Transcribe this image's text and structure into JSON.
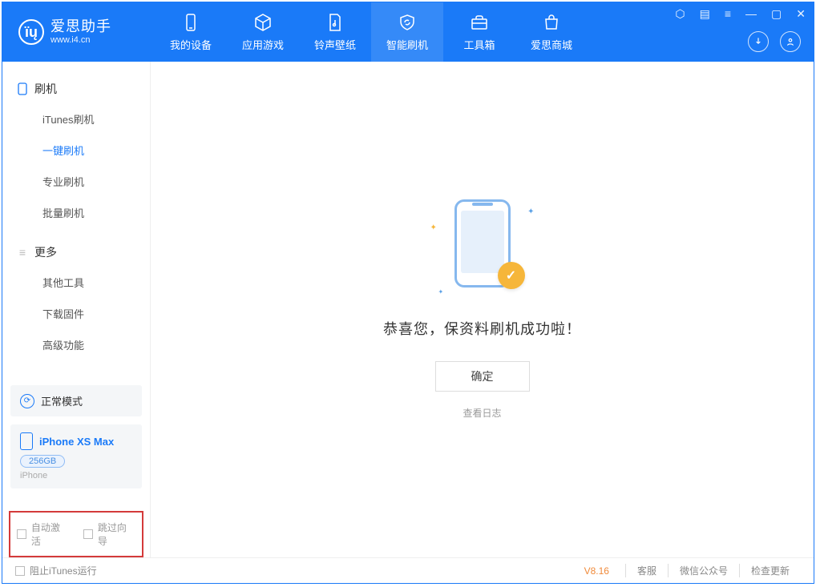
{
  "app": {
    "title": "爱思助手",
    "subtitle": "www.i4.cn"
  },
  "nav": {
    "items": [
      {
        "label": "我的设备"
      },
      {
        "label": "应用游戏"
      },
      {
        "label": "铃声壁纸"
      },
      {
        "label": "智能刷机"
      },
      {
        "label": "工具箱"
      },
      {
        "label": "爱思商城"
      }
    ]
  },
  "sidebar": {
    "group1": {
      "title": "刷机"
    },
    "items1": [
      {
        "label": "iTunes刷机"
      },
      {
        "label": "一键刷机"
      },
      {
        "label": "专业刷机"
      },
      {
        "label": "批量刷机"
      }
    ],
    "group2": {
      "title": "更多"
    },
    "items2": [
      {
        "label": "其他工具"
      },
      {
        "label": "下载固件"
      },
      {
        "label": "高级功能"
      }
    ]
  },
  "device": {
    "mode": "正常模式",
    "name": "iPhone XS Max",
    "storage": "256GB",
    "type": "iPhone"
  },
  "checks": {
    "auto_activate": "自动激活",
    "skip_guide": "跳过向导"
  },
  "main": {
    "success": "恭喜您，保资料刷机成功啦！",
    "ok": "确定",
    "view_log": "查看日志"
  },
  "footer": {
    "block_itunes": "阻止iTunes运行",
    "version": "V8.16",
    "links": [
      "客服",
      "微信公众号",
      "检查更新"
    ]
  }
}
